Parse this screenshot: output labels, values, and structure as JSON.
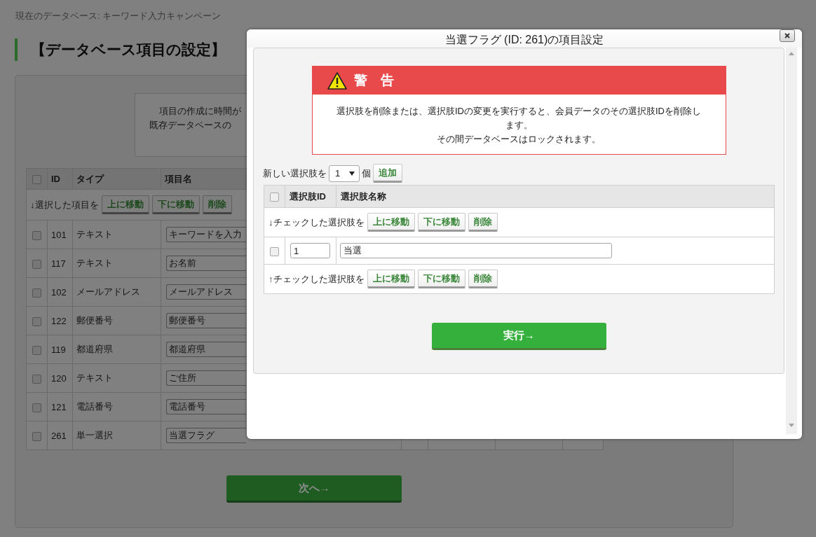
{
  "page": {
    "breadcrumb": "現在のデータベース: キーワード入力キャンペーン",
    "title": "【データベース項目の設定】"
  },
  "notice": {
    "lines": [
      "項目の作成に時間が",
      "既存データベースの"
    ]
  },
  "fields_table": {
    "header_checked": false,
    "columns": [
      "ID",
      "タイプ",
      "項目名"
    ],
    "actions": {
      "label": "↓選択した項目を",
      "buttons": [
        "上に移動",
        "下に移動",
        "削除"
      ]
    },
    "rows": [
      {
        "checked": false,
        "id": "101",
        "type": "テキスト",
        "name": "キーワードを入力"
      },
      {
        "checked": false,
        "id": "117",
        "type": "テキスト",
        "name": "お名前"
      },
      {
        "checked": false,
        "id": "102",
        "type": "メールアドレス",
        "name": "メールアドレス"
      },
      {
        "checked": false,
        "id": "122",
        "type": "郵便番号",
        "name": "郵便番号"
      },
      {
        "checked": false,
        "id": "119",
        "type": "都道府県",
        "name": "都道府県"
      },
      {
        "checked": false,
        "id": "120",
        "type": "テキスト",
        "name": "ご住所"
      },
      {
        "checked": false,
        "id": "121",
        "type": "電話番号",
        "name": "電話番号"
      },
      {
        "checked": false,
        "id": "261",
        "type": "単一選択",
        "name": "当選フラグ"
      }
    ]
  },
  "next_button": "次へ→",
  "dialog": {
    "title": "当選フラグ (ID: 261)の項目設定",
    "warning": {
      "heading": "警　告",
      "lines": [
        "選択肢を削除または、選択肢IDの変更を実行すると、会員データのその選択肢IDを削除します。",
        "その間データベースはロックされます。"
      ]
    },
    "add_row": {
      "label": "新しい選択肢を",
      "count": "1",
      "unit": "個",
      "button": "追加"
    },
    "options_table": {
      "header_checked": false,
      "columns": [
        "選択肢ID",
        "選択肢名称"
      ],
      "top_actions": {
        "label": "↓チェックした選択肢を",
        "buttons": [
          "上に移動",
          "下に移動",
          "削除"
        ]
      },
      "rows": [
        {
          "checked": false,
          "id": "1",
          "name": "当選"
        }
      ],
      "bottom_actions": {
        "label": "↑チェックした選択肢を",
        "buttons": [
          "上に移動",
          "下に移動",
          "削除"
        ]
      }
    },
    "submit_button": "実行→"
  }
}
